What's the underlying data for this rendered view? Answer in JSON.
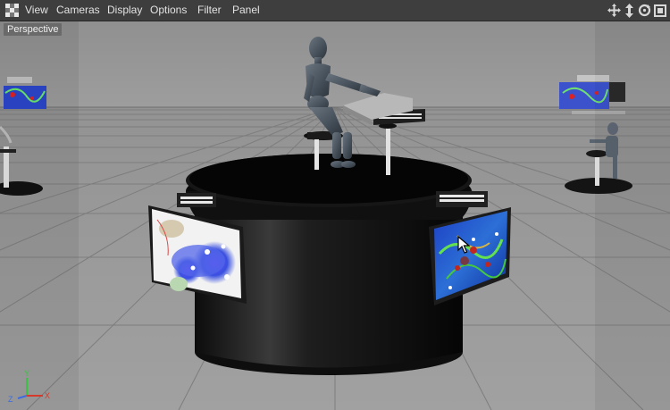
{
  "menu": {
    "items": [
      "View",
      "Cameras",
      "Display",
      "Options",
      "Filter",
      "Panel"
    ]
  },
  "viewport": {
    "label": "Perspective"
  },
  "axes": {
    "x": "X",
    "y": "Y",
    "z": "Z"
  },
  "colors": {
    "menubar": "#3e3e3e",
    "viewport_bg": "#929292",
    "grid": "#7a7a7a",
    "axis_x": "#d63a2a",
    "axis_y": "#39c244",
    "axis_z": "#3e6cde"
  },
  "icons": {
    "app": "checker-icon",
    "nav": [
      "move-view-icon",
      "dolly-view-icon",
      "rotate-view-icon",
      "maximize-view-icon"
    ]
  }
}
